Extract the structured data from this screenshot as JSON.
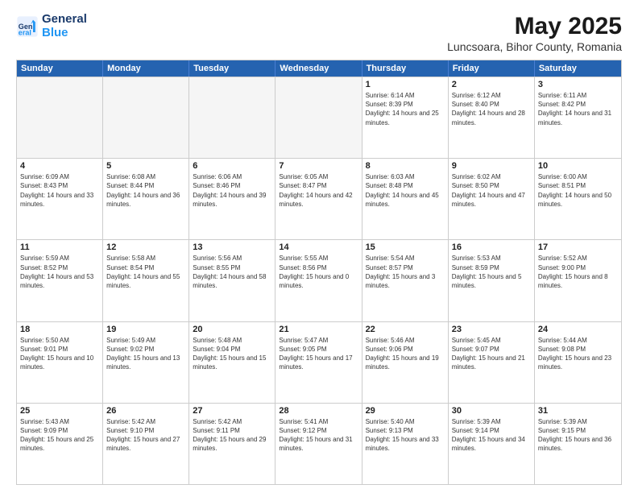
{
  "logo": {
    "line1": "General",
    "line2": "Blue"
  },
  "title": "May 2025",
  "subtitle": "Luncsoara, Bihor County, Romania",
  "weekdays": [
    "Sunday",
    "Monday",
    "Tuesday",
    "Wednesday",
    "Thursday",
    "Friday",
    "Saturday"
  ],
  "rows": [
    [
      {
        "day": "",
        "empty": true
      },
      {
        "day": "",
        "empty": true
      },
      {
        "day": "",
        "empty": true
      },
      {
        "day": "",
        "empty": true
      },
      {
        "day": "1",
        "sunrise": "6:14 AM",
        "sunset": "8:39 PM",
        "daylight": "14 hours and 25 minutes."
      },
      {
        "day": "2",
        "sunrise": "6:12 AM",
        "sunset": "8:40 PM",
        "daylight": "14 hours and 28 minutes."
      },
      {
        "day": "3",
        "sunrise": "6:11 AM",
        "sunset": "8:42 PM",
        "daylight": "14 hours and 31 minutes."
      }
    ],
    [
      {
        "day": "4",
        "sunrise": "6:09 AM",
        "sunset": "8:43 PM",
        "daylight": "14 hours and 33 minutes."
      },
      {
        "day": "5",
        "sunrise": "6:08 AM",
        "sunset": "8:44 PM",
        "daylight": "14 hours and 36 minutes."
      },
      {
        "day": "6",
        "sunrise": "6:06 AM",
        "sunset": "8:46 PM",
        "daylight": "14 hours and 39 minutes."
      },
      {
        "day": "7",
        "sunrise": "6:05 AM",
        "sunset": "8:47 PM",
        "daylight": "14 hours and 42 minutes."
      },
      {
        "day": "8",
        "sunrise": "6:03 AM",
        "sunset": "8:48 PM",
        "daylight": "14 hours and 45 minutes."
      },
      {
        "day": "9",
        "sunrise": "6:02 AM",
        "sunset": "8:50 PM",
        "daylight": "14 hours and 47 minutes."
      },
      {
        "day": "10",
        "sunrise": "6:00 AM",
        "sunset": "8:51 PM",
        "daylight": "14 hours and 50 minutes."
      }
    ],
    [
      {
        "day": "11",
        "sunrise": "5:59 AM",
        "sunset": "8:52 PM",
        "daylight": "14 hours and 53 minutes."
      },
      {
        "day": "12",
        "sunrise": "5:58 AM",
        "sunset": "8:54 PM",
        "daylight": "14 hours and 55 minutes."
      },
      {
        "day": "13",
        "sunrise": "5:56 AM",
        "sunset": "8:55 PM",
        "daylight": "14 hours and 58 minutes."
      },
      {
        "day": "14",
        "sunrise": "5:55 AM",
        "sunset": "8:56 PM",
        "daylight": "15 hours and 0 minutes."
      },
      {
        "day": "15",
        "sunrise": "5:54 AM",
        "sunset": "8:57 PM",
        "daylight": "15 hours and 3 minutes."
      },
      {
        "day": "16",
        "sunrise": "5:53 AM",
        "sunset": "8:59 PM",
        "daylight": "15 hours and 5 minutes."
      },
      {
        "day": "17",
        "sunrise": "5:52 AM",
        "sunset": "9:00 PM",
        "daylight": "15 hours and 8 minutes."
      }
    ],
    [
      {
        "day": "18",
        "sunrise": "5:50 AM",
        "sunset": "9:01 PM",
        "daylight": "15 hours and 10 minutes."
      },
      {
        "day": "19",
        "sunrise": "5:49 AM",
        "sunset": "9:02 PM",
        "daylight": "15 hours and 13 minutes."
      },
      {
        "day": "20",
        "sunrise": "5:48 AM",
        "sunset": "9:04 PM",
        "daylight": "15 hours and 15 minutes."
      },
      {
        "day": "21",
        "sunrise": "5:47 AM",
        "sunset": "9:05 PM",
        "daylight": "15 hours and 17 minutes."
      },
      {
        "day": "22",
        "sunrise": "5:46 AM",
        "sunset": "9:06 PM",
        "daylight": "15 hours and 19 minutes."
      },
      {
        "day": "23",
        "sunrise": "5:45 AM",
        "sunset": "9:07 PM",
        "daylight": "15 hours and 21 minutes."
      },
      {
        "day": "24",
        "sunrise": "5:44 AM",
        "sunset": "9:08 PM",
        "daylight": "15 hours and 23 minutes."
      }
    ],
    [
      {
        "day": "25",
        "sunrise": "5:43 AM",
        "sunset": "9:09 PM",
        "daylight": "15 hours and 25 minutes."
      },
      {
        "day": "26",
        "sunrise": "5:42 AM",
        "sunset": "9:10 PM",
        "daylight": "15 hours and 27 minutes."
      },
      {
        "day": "27",
        "sunrise": "5:42 AM",
        "sunset": "9:11 PM",
        "daylight": "15 hours and 29 minutes."
      },
      {
        "day": "28",
        "sunrise": "5:41 AM",
        "sunset": "9:12 PM",
        "daylight": "15 hours and 31 minutes."
      },
      {
        "day": "29",
        "sunrise": "5:40 AM",
        "sunset": "9:13 PM",
        "daylight": "15 hours and 33 minutes."
      },
      {
        "day": "30",
        "sunrise": "5:39 AM",
        "sunset": "9:14 PM",
        "daylight": "15 hours and 34 minutes."
      },
      {
        "day": "31",
        "sunrise": "5:39 AM",
        "sunset": "9:15 PM",
        "daylight": "15 hours and 36 minutes."
      }
    ]
  ]
}
